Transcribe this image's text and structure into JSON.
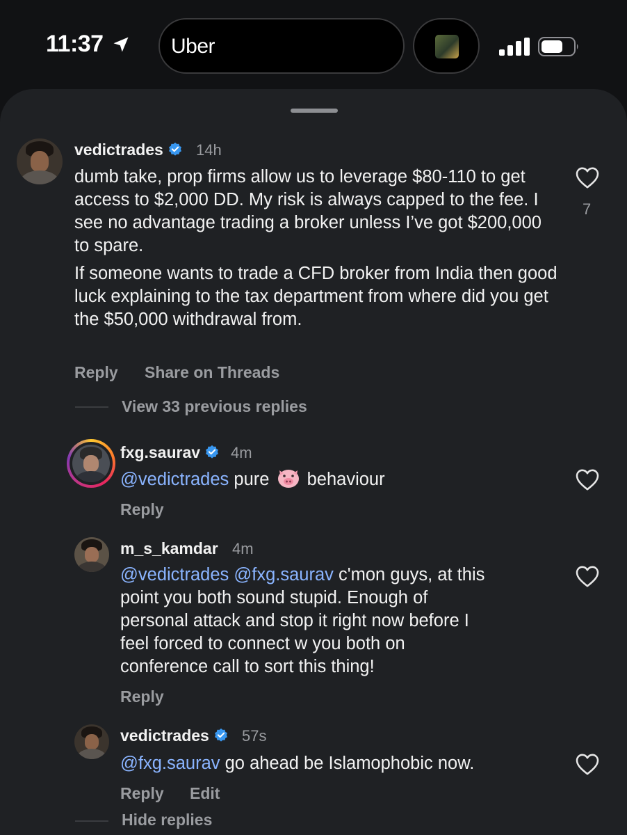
{
  "status_bar": {
    "time": "11:37",
    "live_activity_label": "Uber"
  },
  "comments": [
    {
      "username": "vedictrades",
      "verified": true,
      "time": "14h",
      "paragraph1": "dumb take, prop firms allow us to leverage $80-110 to get access to $2,000 DD. My risk is always capped to the fee. I see no advantage trading a broker unless I’ve got $200,000 to spare.",
      "paragraph2": "If someone wants to trade a CFD broker from India then good luck explaining to the tax department from where did you get the $50,000 withdrawal from.",
      "like_count": "7",
      "reply_label": "Reply",
      "share_label": "Share on Threads"
    }
  ],
  "view_previous_label": "View 33 previous replies",
  "replies": [
    {
      "username": "fxg.saurav",
      "verified": true,
      "time": "4m",
      "mention": "@vedictrades",
      "text_before_emoji": " pure ",
      "emoji": "pig-face",
      "text_after_emoji": " behaviour",
      "reply_label": "Reply"
    },
    {
      "username": "m_s_kamdar",
      "verified": false,
      "time": "4m",
      "mention1": "@vedictrades",
      "mention2": "@fxg.saurav",
      "text_line1": " c'mon guys, at this",
      "text_line2": "point you both sound stupid. Enough of",
      "text_line3": "personal attack and stop it right now before I",
      "text_line4": "feel forced to connect w you both on",
      "text_line5": "conference call to sort this thing!",
      "reply_label": "Reply"
    },
    {
      "username": "vedictrades",
      "verified": true,
      "time": "57s",
      "mention": "@fxg.saurav",
      "text": " go ahead be Islamophobic now.",
      "reply_label": "Reply",
      "edit_label": "Edit"
    }
  ],
  "hide_replies_label": "Hide replies",
  "colors": {
    "background": "#111214",
    "sheet": "#1f2124",
    "mention": "#8ab4ff",
    "verified": "#3897f0",
    "secondary_text": "#9a9ca0"
  },
  "icons": [
    "location-arrow-icon",
    "signal-icon",
    "battery-icon",
    "verified-icon",
    "heart-icon",
    "pig-emoji"
  ]
}
